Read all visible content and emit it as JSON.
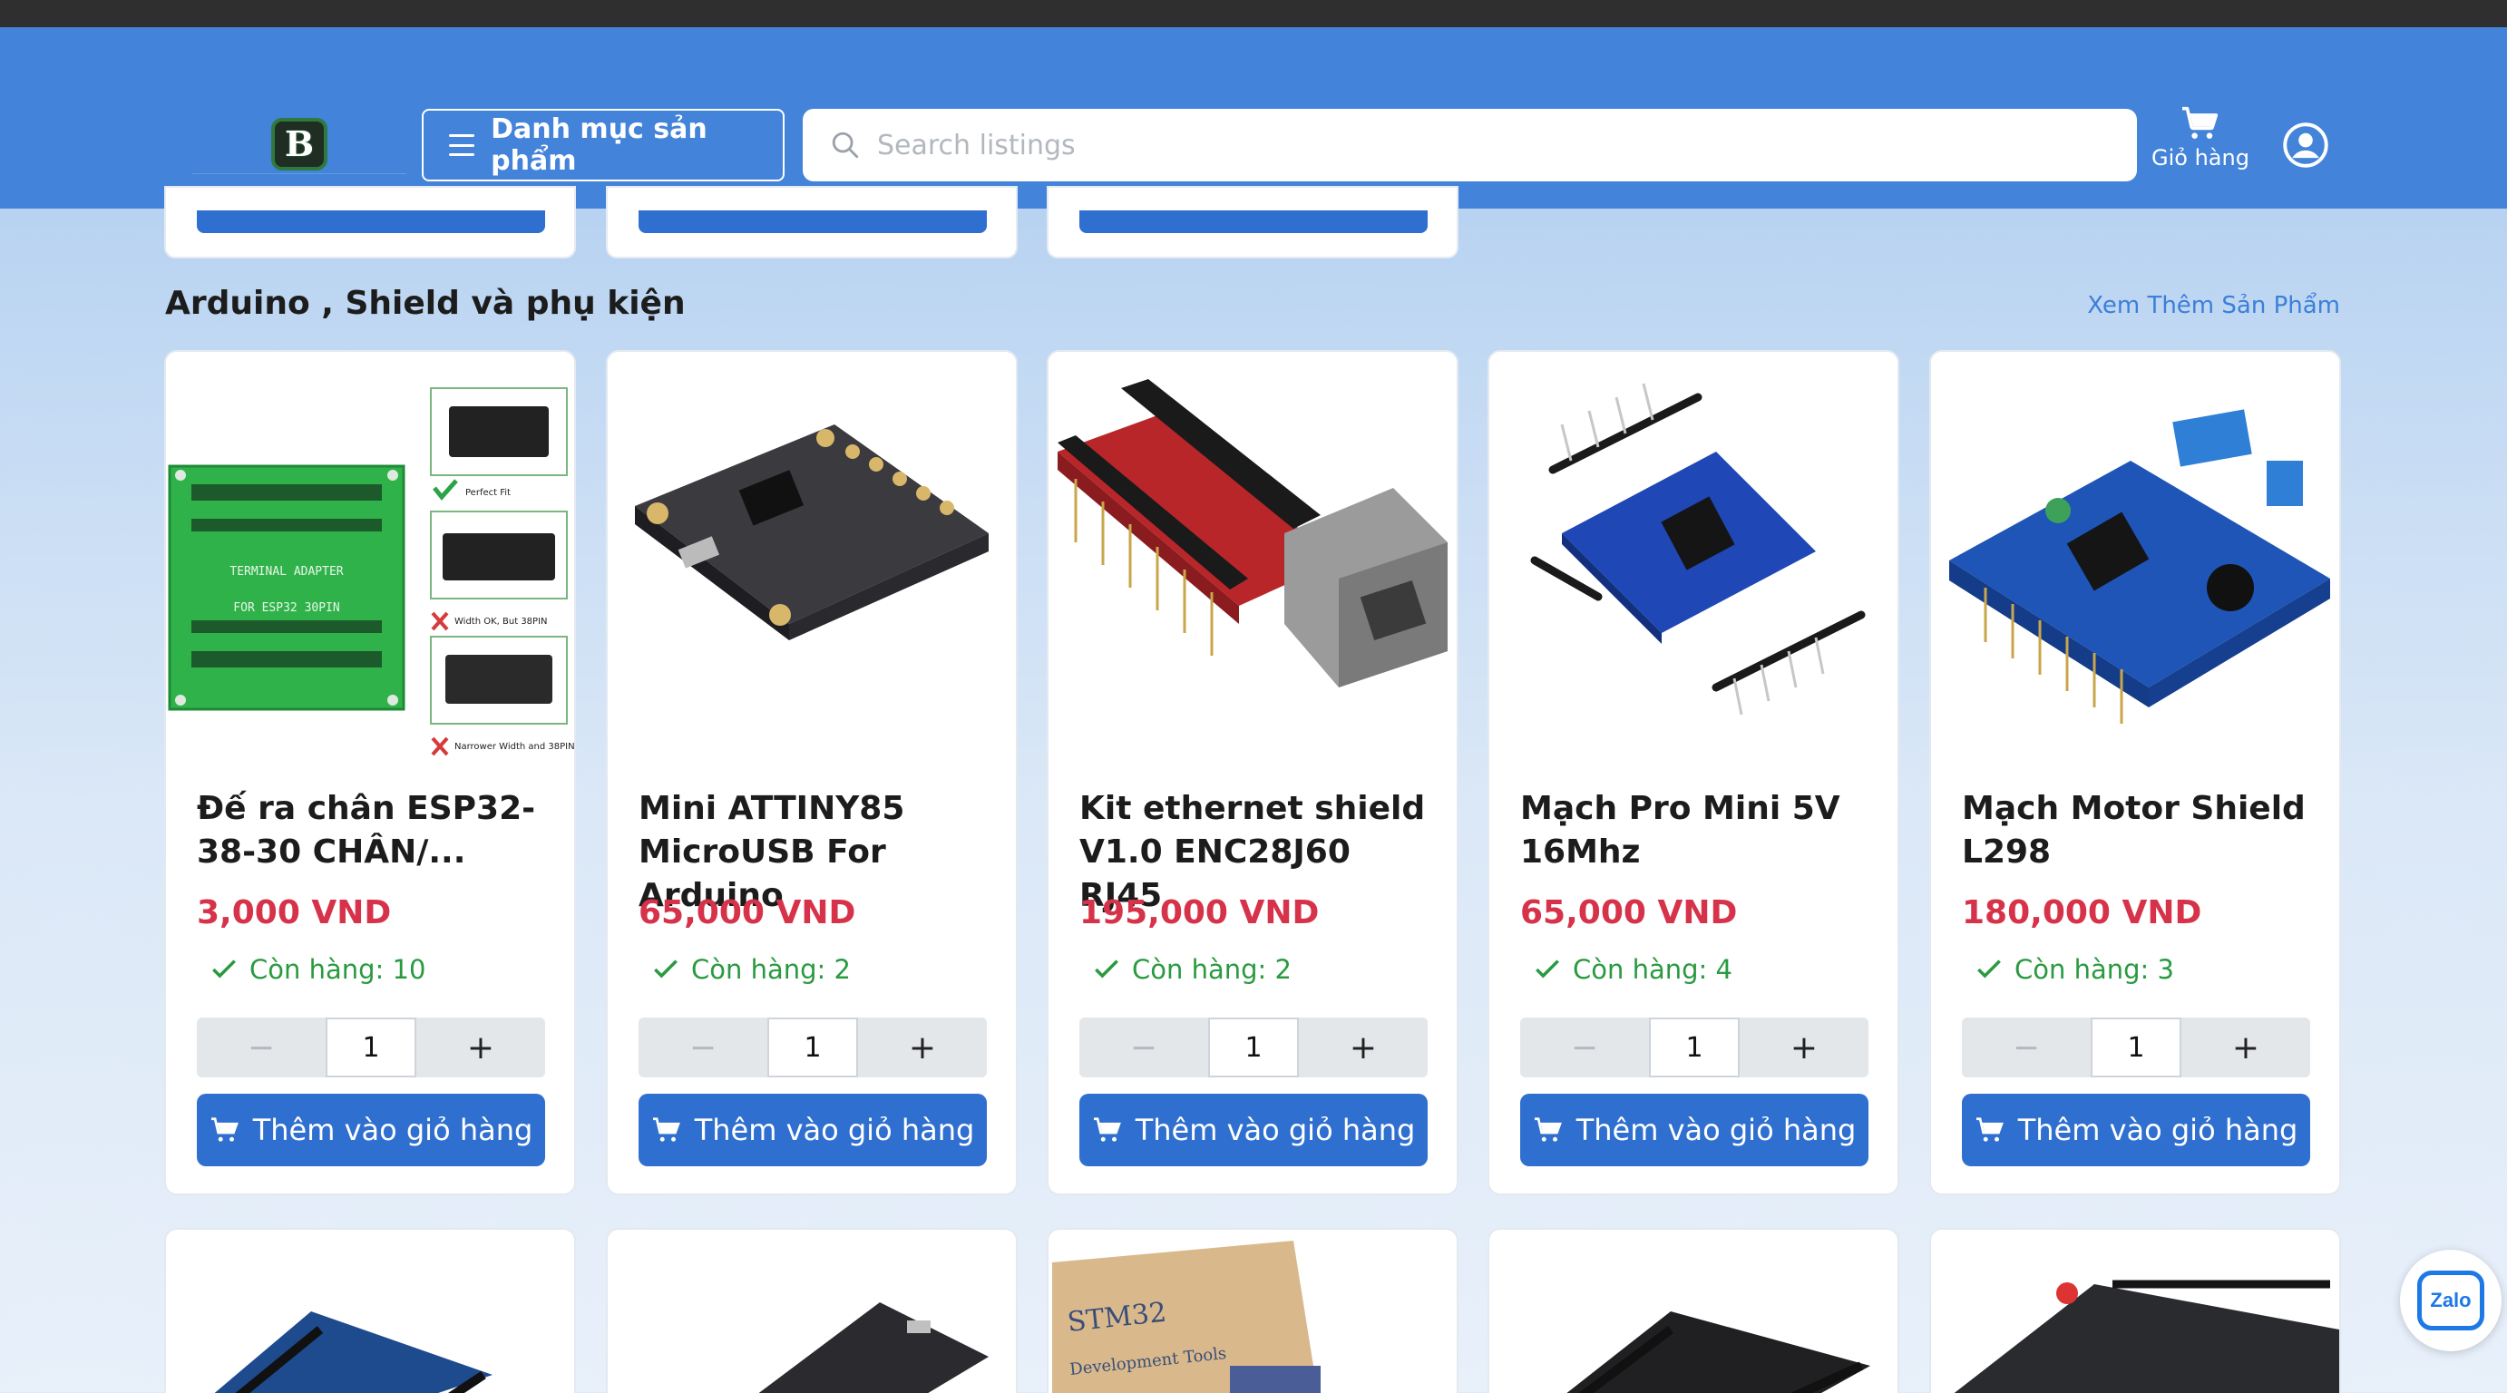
{
  "header": {
    "logo_letter": "B",
    "category_button_label": "Danh mục sản phẩm",
    "search_placeholder": "Search listings",
    "cart_label": "Giỏ hàng"
  },
  "section": {
    "title": "Arduino , Shield và phụ kiện",
    "see_more": "Xem Thêm Sản Phẩm"
  },
  "products": [
    {
      "name": "Đế ra chân ESP32-38-30 CHÂN/...",
      "price": "3,000 VND",
      "stock": "Còn hàng: 10",
      "qty": "1",
      "minus": "−",
      "plus": "+",
      "add": "Thêm vào giỏ hàng",
      "image_text": [
        "TERMINAL ADAPTER",
        "FOR ESP32 30PIN",
        "Perfect Fit",
        "Width OK, But 38PIN",
        "Narrower Width and 38PIN"
      ]
    },
    {
      "name": "Mini ATTINY85 MicroUSB For Arduino",
      "price": "65,000 VND",
      "stock": "Còn hàng: 2",
      "qty": "1",
      "minus": "−",
      "plus": "+",
      "add": "Thêm vào giỏ hàng"
    },
    {
      "name": "Kit ethernet shield V1.0 ENC28J60 RJ45",
      "price": "195,000 VND",
      "stock": "Còn hàng: 2",
      "qty": "1",
      "minus": "−",
      "plus": "+",
      "add": "Thêm vào giỏ hàng"
    },
    {
      "name": "Mạch Pro Mini 5V 16Mhz",
      "price": "65,000 VND",
      "stock": "Còn hàng: 4",
      "qty": "1",
      "minus": "−",
      "plus": "+",
      "add": "Thêm vào giỏ hàng"
    },
    {
      "name": "Mạch Motor Shield L298",
      "price": "180,000 VND",
      "stock": "Còn hàng: 3",
      "qty": "1",
      "minus": "−",
      "plus": "+",
      "add": "Thêm vào giỏ hàng"
    }
  ],
  "next_row": {
    "stm32_text": "STM32",
    "stm32_sub": "Development Tools"
  },
  "zalo_label": "Zalo",
  "colors": {
    "header_bg": "#4383d9",
    "button_blue": "#2f6fcf",
    "price_red": "#d6334a",
    "stock_green": "#2a9a40",
    "link_blue": "#3b7fd9"
  }
}
